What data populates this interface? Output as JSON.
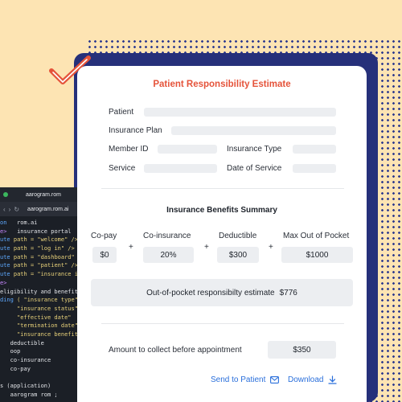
{
  "card": {
    "title": "Patient Responsibility Estimate",
    "fields": {
      "patient": "Patient",
      "insurance_plan": "Insurance Plan",
      "member_id": "Member ID",
      "insurance_type": "Insurance Type",
      "service": "Service",
      "date_of_service": "Date of Service"
    },
    "benefits": {
      "title": "Insurance Benefits Summary",
      "items": [
        {
          "label": "Co-pay",
          "value": "$0"
        },
        {
          "label": "Co-insurance",
          "value": "20%"
        },
        {
          "label": "Deductible",
          "value": "$300"
        },
        {
          "label": "Max Out of Pocket",
          "value": "$1000"
        }
      ],
      "operator": "+"
    },
    "estimate": {
      "label": "Out-of-pocket responsibilty estimate",
      "value": "$776"
    },
    "collect": {
      "label": "Amount to collect before appointment",
      "value": "$350"
    },
    "actions": {
      "send": "Send to Patient",
      "download": "Download"
    }
  },
  "editor": {
    "tab_title": "aarogram.rom",
    "url": "aarogram.rom.ai",
    "lines": [
      {
        "a": "on",
        "b": "   rom.ai"
      },
      {
        "a": "e>",
        "b": "   insurance portal"
      },
      {
        "a": "ute",
        "b": " path = \"welcome\" />"
      },
      {
        "a": "ute",
        "b": " path = \"log in\" />"
      },
      {
        "a": "ute",
        "b": " path = \"dashboard\" />"
      },
      {
        "a": "ute",
        "b": " path = \"patient\" />"
      },
      {
        "a": "ute",
        "b": " path = \"insurance id\" />"
      },
      {
        "a": "e>",
        "b": ""
      },
      {
        "a": "",
        "b": "eligibility and benefit"
      },
      {
        "a": "ding",
        "b": " ( \"insurance type\""
      },
      {
        "a": "",
        "b": "     \"insurance status\""
      },
      {
        "a": "",
        "b": "     \"effective date\""
      },
      {
        "a": "",
        "b": "     \"termination date\""
      },
      {
        "a": "",
        "b": "     \"insurance benefit\" )"
      },
      {
        "a": "",
        "b": "   deductible"
      },
      {
        "a": "",
        "b": "   oop"
      },
      {
        "a": "",
        "b": "   co-insurance"
      },
      {
        "a": "",
        "b": "   co-pay"
      },
      {
        "a": "",
        "b": ""
      },
      {
        "a": "",
        "b": "s (application)"
      },
      {
        "a": "",
        "b": "   aarogram rom ;"
      }
    ]
  },
  "colors": {
    "accent": "#e5533a",
    "link": "#2a6fdb",
    "navy": "#26307a",
    "background": "#fde4b3"
  }
}
